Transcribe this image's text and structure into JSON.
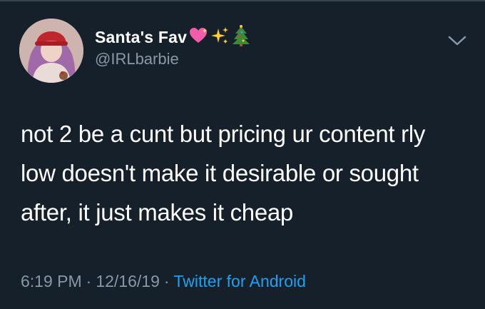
{
  "colors": {
    "background": "#15202b",
    "text": "#ffffff",
    "secondary": "#8899a6",
    "link": "#1da1f2"
  },
  "author": {
    "display_name": "Santa's Fav",
    "handle": "@IRLbarbie",
    "name_emojis": [
      "sparkling-heart-icon",
      "sparkles-icon",
      "christmas-tree-icon"
    ]
  },
  "tweet": {
    "lines": [
      "not 2 be a cunt but pricing ur content rly",
      "low doesn't make it desirable or sought",
      "after, it just makes it cheap"
    ],
    "time": "6:19 PM",
    "separator_1": "·",
    "date": "12/16/19",
    "separator_2": "·",
    "source": "Twitter for Android"
  }
}
